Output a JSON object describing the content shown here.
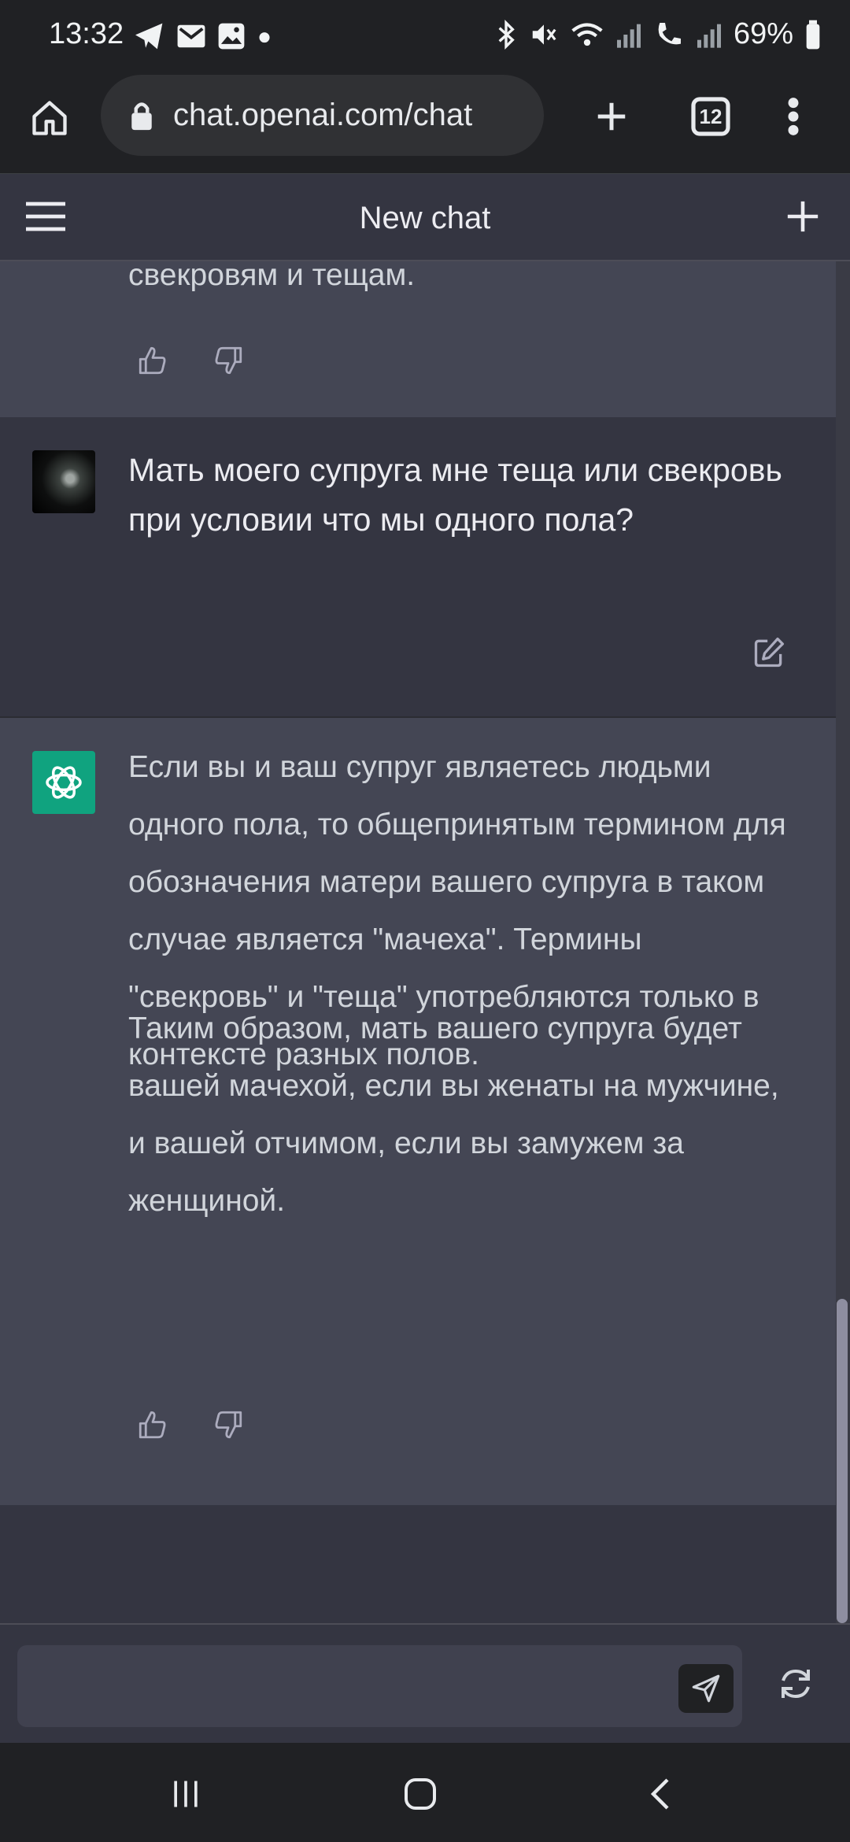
{
  "statusbar": {
    "time": "13:32",
    "battery_pct": "69%"
  },
  "browser": {
    "url": "chat.openai.com/chat",
    "tab_count": "12"
  },
  "header": {
    "title": "New chat"
  },
  "messages": {
    "prev_assistant_tail": "свекровям и тещам.",
    "user_message": "Мать моего супруга мне теща или свекровь при условии что мы одного пола?",
    "assistant_para1": "Если вы и ваш супруг являетесь людьми одного пола, то общепринятым термином для обозначения матери вашего супруга в таком случае является \"мачеха\". Термины \"свекровь\" и \"теща\" употребляются только в контексте разных полов.",
    "assistant_para2": "Таким образом, мать вашего супруга будет вашей мачехой, если вы женаты на мужчине, и вашей отчимом, если вы замужем за женщиной."
  },
  "input": {
    "placeholder": ""
  },
  "icons": {
    "status": [
      "telegram-icon",
      "mail-icon",
      "image-icon",
      "dot-icon",
      "bluetooth-icon",
      "mute-icon",
      "wifi-icon",
      "signal-icon",
      "wifi-call-icon",
      "battery-icon"
    ],
    "browser": [
      "home-icon",
      "lock-icon",
      "plus-icon",
      "tabs-icon",
      "more-icon"
    ],
    "chat": [
      "menu-icon",
      "new-chat-icon",
      "thumbs-up-icon",
      "thumbs-down-icon",
      "edit-icon",
      "openai-icon",
      "send-icon",
      "regenerate-icon"
    ],
    "nav": [
      "recents-icon",
      "home-nav-icon",
      "back-icon"
    ]
  },
  "colors": {
    "accent": "#10a37f",
    "assistant_bg": "#444654",
    "user_bg": "#343541"
  }
}
